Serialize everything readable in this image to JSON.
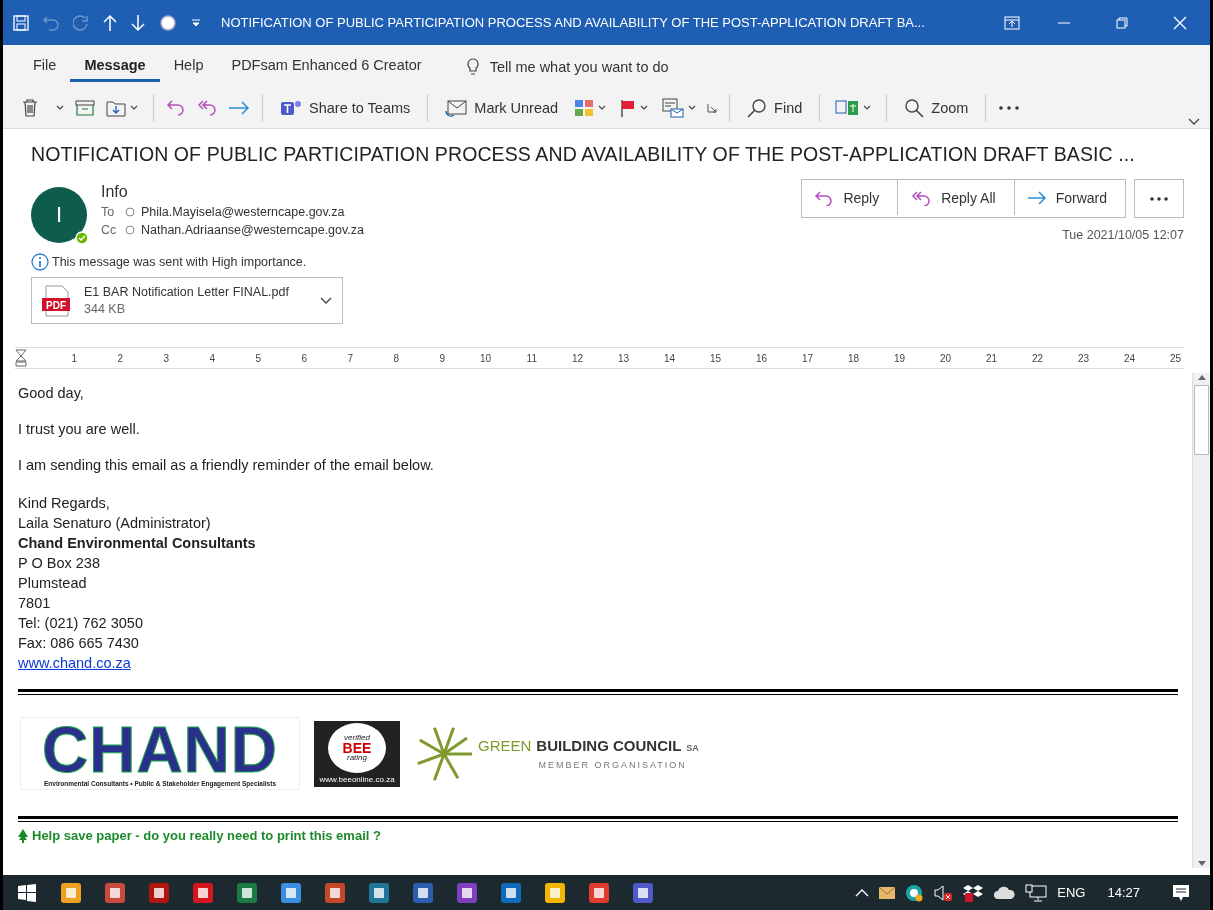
{
  "window": {
    "title": "NOTIFICATION OF PUBLIC PARTICIPATION PROCESS AND AVAILABILITY OF THE POST-APPLICATION DRAFT BA..."
  },
  "menu_tabs": [
    {
      "label": "File",
      "selected": false
    },
    {
      "label": "Message",
      "selected": true
    },
    {
      "label": "Help",
      "selected": false
    },
    {
      "label": "PDFsam Enhanced 6 Creator",
      "selected": false
    }
  ],
  "tell_me": "Tell me what you want to do",
  "toolbar": {
    "share": "Share to Teams",
    "mark_unread": "Mark Unread",
    "find": "Find",
    "zoom": "Zoom"
  },
  "message": {
    "subject": "NOTIFICATION OF PUBLIC PARTICIPATION PROCESS AND AVAILABILITY OF THE POST-APPLICATION DRAFT BASIC ...",
    "sender_initial": "I",
    "sender": "Info",
    "to_label": "To",
    "to": "Phila.Mayisela@westerncape.gov.za",
    "cc_label": "Cc",
    "cc": "Nathan.Adriaanse@westerncape.gov.za",
    "importance": "This message was sent with High importance.",
    "attachment": {
      "name": "E1 BAR Notification Letter FINAL.pdf",
      "size": "344 KB",
      "type_label": "PDF"
    },
    "actions": [
      {
        "kind": "reply",
        "label": "Reply"
      },
      {
        "kind": "reply_all",
        "label": "Reply All"
      },
      {
        "kind": "forward",
        "label": "Forward"
      }
    ],
    "date": "Tue 2021/10/05 12:07"
  },
  "ruler_marks": [
    "1",
    "2",
    "3",
    "4",
    "5",
    "6",
    "7",
    "8",
    "9",
    "10",
    "11",
    "12",
    "13",
    "14",
    "15",
    "16",
    "17",
    "18",
    "19",
    "20",
    "21",
    "22",
    "23",
    "24",
    "25"
  ],
  "body": {
    "paragraphs": [
      "Good day,",
      "I trust you are well.",
      "I am sending this email as a friendly reminder of the email below."
    ],
    "signature": [
      {
        "kind": "text",
        "text": "Kind Regards,"
      },
      {
        "kind": "text",
        "text": "Laila Senaturo (Administrator)"
      },
      {
        "kind": "bold",
        "text": "Chand Environmental Consultants"
      },
      {
        "kind": "text",
        "text": "P O Box 238"
      },
      {
        "kind": "text",
        "text": "Plumstead"
      },
      {
        "kind": "text",
        "text": "7801"
      },
      {
        "kind": "text",
        "text": "Tel:  (021) 762 3050"
      },
      {
        "kind": "text",
        "text": "Fax: 086 665 7430"
      },
      {
        "kind": "link",
        "text": "www.chand.co.za"
      }
    ],
    "logos": {
      "chand": "CHAND",
      "chand_tagline": "Environmental Consultants • Public & Stakeholder Engagement Specialists",
      "bee_top": "verified",
      "bee_main": "BEE",
      "bee_bottom": "rating",
      "bee_url": "www.beeonline.co.za",
      "gbc_green": "GREEN",
      "gbc_name": "BUILDING COUNCIL",
      "gbc_sa": "SA",
      "gbc_member": "MEMBER ORGANISATION"
    },
    "save_paper": "Help save paper - do you really need to print this email ?"
  },
  "taskbar": {
    "language": "ENG",
    "time": "14:27"
  }
}
